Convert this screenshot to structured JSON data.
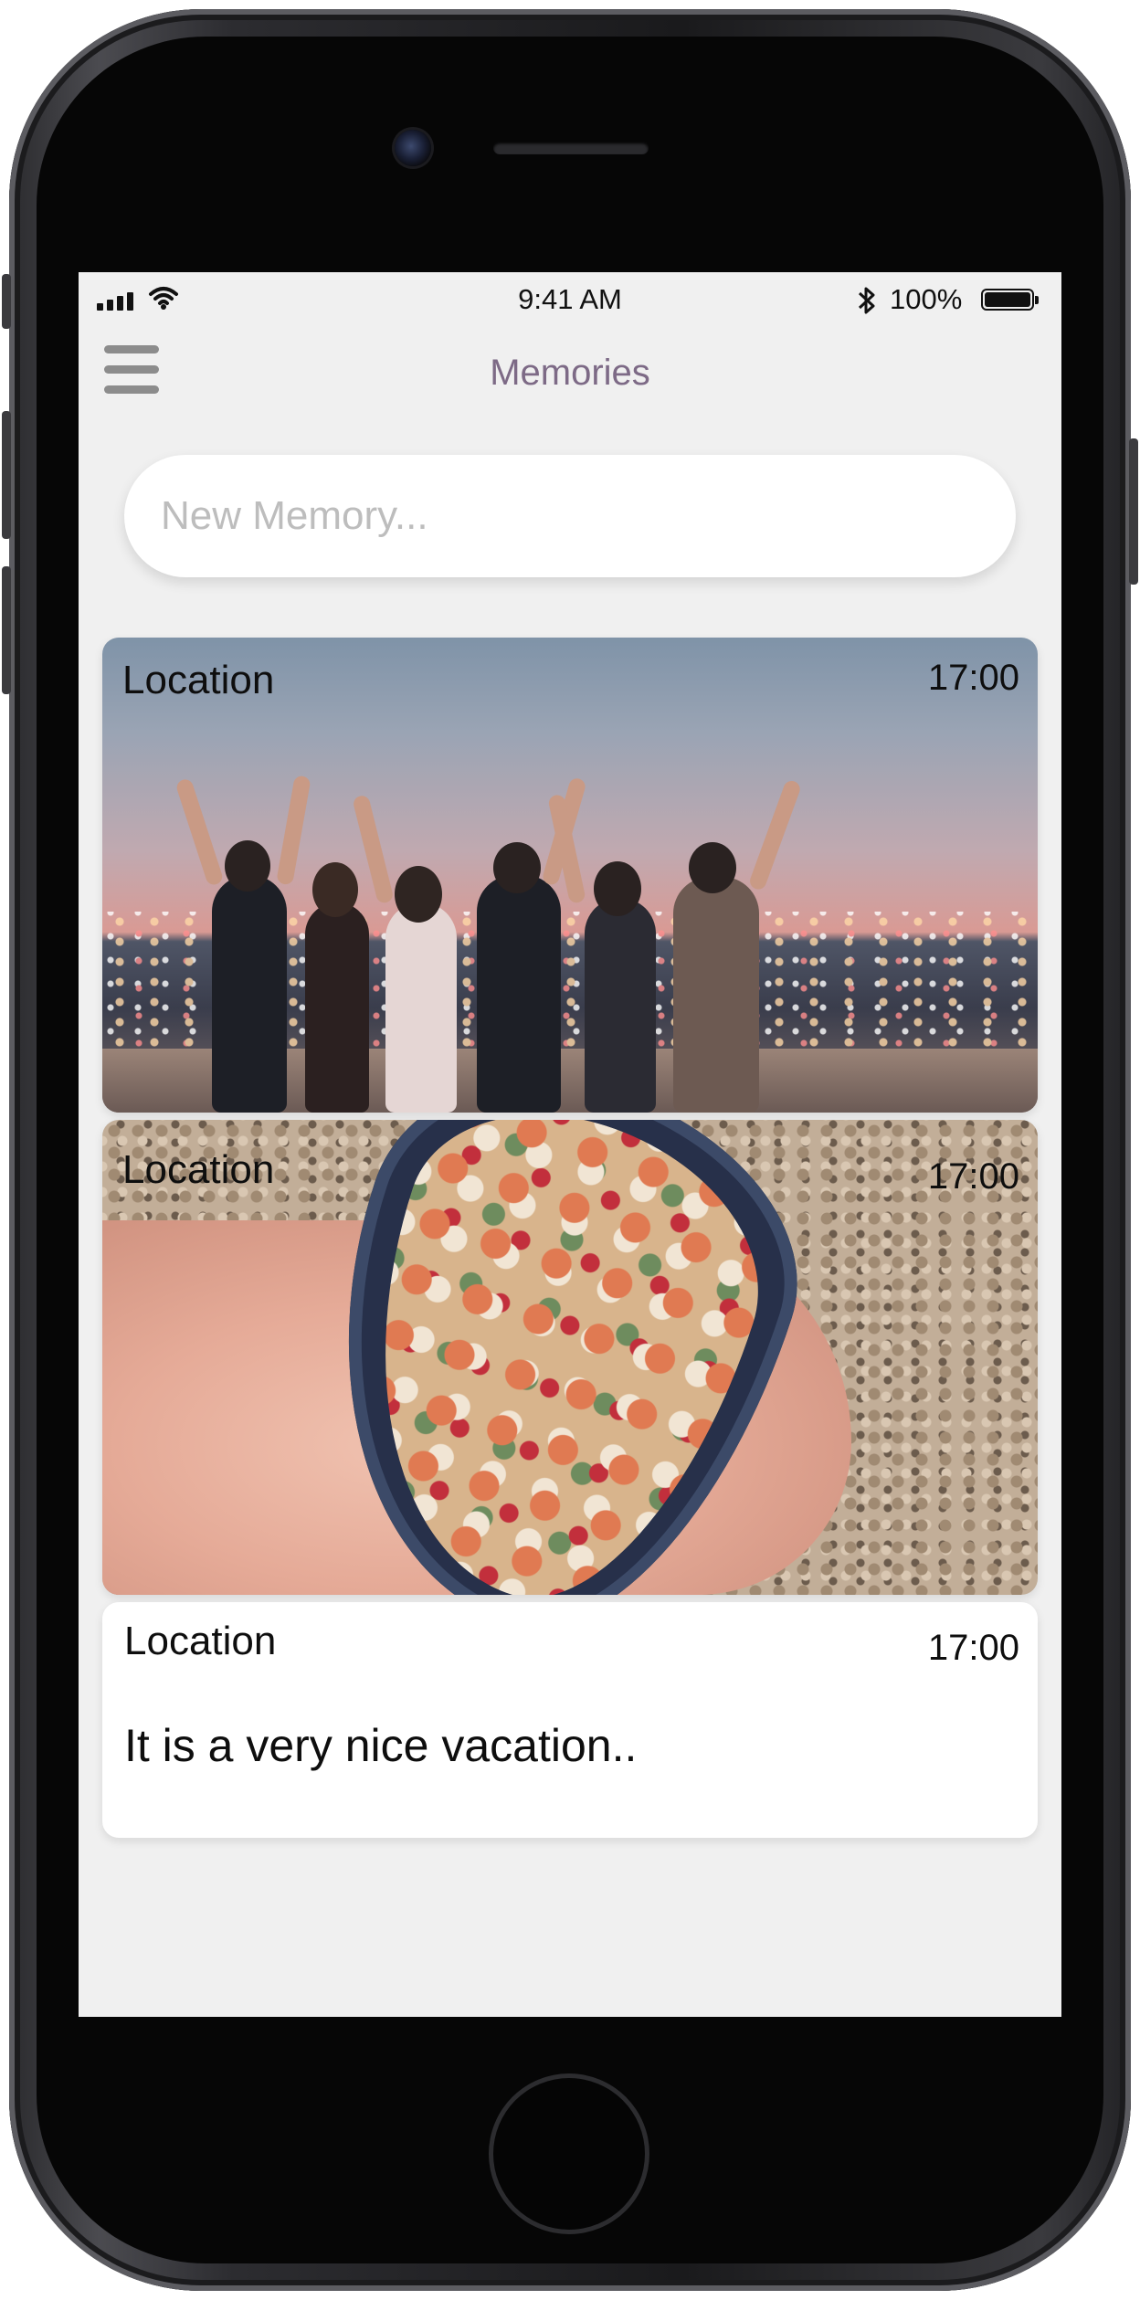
{
  "status_bar": {
    "time": "9:41 AM",
    "battery_percent": "100%",
    "bluetooth_icon": "bluetooth-icon",
    "signal_icon": "cellular-signal-icon",
    "wifi_icon": "wifi-icon",
    "battery_icon": "battery-icon"
  },
  "nav": {
    "title": "Memories",
    "menu_icon": "hamburger-menu-icon"
  },
  "new_memory": {
    "placeholder": "New Memory...",
    "value": ""
  },
  "memories": [
    {
      "location": "Location",
      "time": "17:00",
      "image": "group-of-friends-at-sunset-photo"
    },
    {
      "location": "Location",
      "time": "17:00",
      "image": "hand-holding-mussel-shell-with-seashells-photo"
    },
    {
      "location": "Location",
      "time": "17:00",
      "text": "It is a very nice vacation.."
    }
  ],
  "colors": {
    "title": "#7d6a86",
    "background": "#f0f0f0",
    "card": "#ffffff"
  }
}
